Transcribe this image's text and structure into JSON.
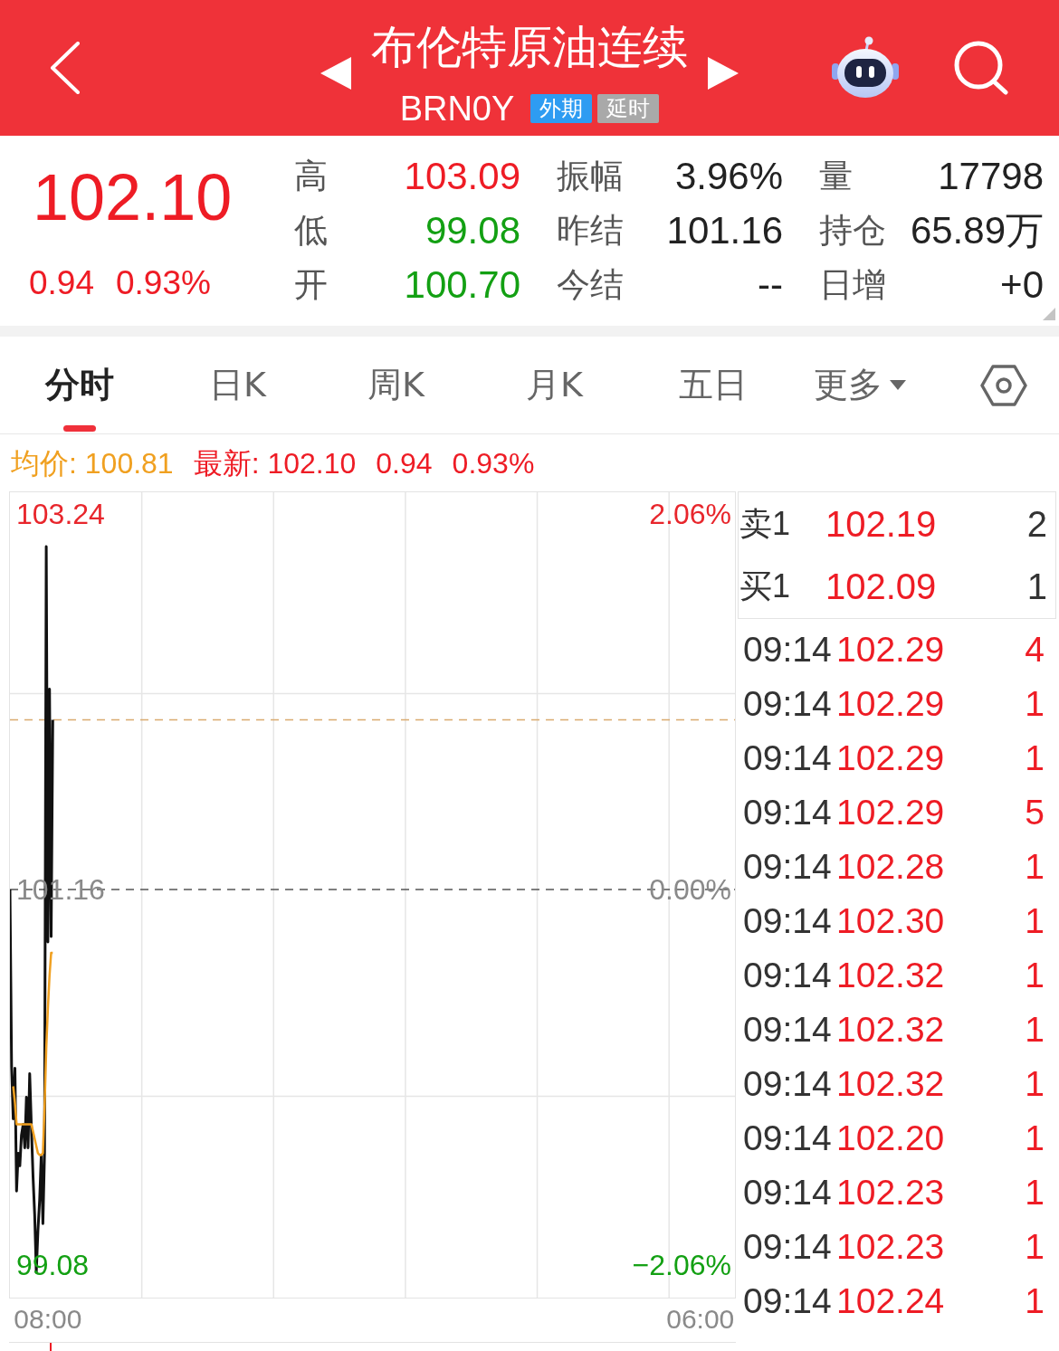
{
  "header": {
    "title": "布伦特原油连续",
    "code": "BRN0Y",
    "badges": [
      {
        "label": "外期",
        "color": "#2e9cf2"
      },
      {
        "label": "延时",
        "color": "#a9a9a9"
      }
    ]
  },
  "quote": {
    "price": {
      "text": "102.10",
      "color": "#ee1c25"
    },
    "changes": [
      {
        "text": "0.94",
        "color": "#ee1c25"
      },
      {
        "text": "0.93%",
        "color": "#ee1c25"
      }
    ],
    "stats": [
      {
        "label": "高",
        "value": "103.09",
        "color": "#ee1c25"
      },
      {
        "label": "振幅",
        "value": "3.96%",
        "color": "#222222"
      },
      {
        "label": "量",
        "value": "17798",
        "color": "#222222"
      },
      {
        "label": "低",
        "value": "99.08",
        "color": "#13a013"
      },
      {
        "label": "昨结",
        "value": "101.16",
        "color": "#222222"
      },
      {
        "label": "持仓",
        "value": "65.89万",
        "color": "#222222"
      },
      {
        "label": "开",
        "value": "100.70",
        "color": "#13a013"
      },
      {
        "label": "今结",
        "value": "--",
        "color": "#222222"
      },
      {
        "label": "日增",
        "value": "+0",
        "color": "#222222"
      }
    ]
  },
  "tabs": [
    {
      "label": "分时",
      "selected": true,
      "kind": "view"
    },
    {
      "label": "日K",
      "selected": false,
      "kind": "view"
    },
    {
      "label": "周K",
      "selected": false,
      "kind": "view"
    },
    {
      "label": "月K",
      "selected": false,
      "kind": "view"
    },
    {
      "label": "五日",
      "selected": false,
      "kind": "view"
    },
    {
      "label": "更多",
      "selected": false,
      "kind": "dropdown"
    }
  ],
  "info_line": [
    {
      "text": "均价: 100.81",
      "color": "#f0a020"
    },
    {
      "text": "最新: 102.10",
      "color": "#ee1c25"
    },
    {
      "text": "0.94",
      "color": "#ee1c25"
    },
    {
      "text": "0.93%",
      "color": "#ee1c25"
    }
  ],
  "chart": {
    "change_labels": [
      "2.06%",
      "0.00%",
      "−2.06%"
    ],
    "chart_data": {
      "type": "line",
      "categories": [
        null,
        null,
        null,
        null,
        null,
        null,
        null,
        null,
        null,
        null,
        null,
        null,
        null,
        null,
        null,
        null,
        null,
        null,
        null,
        null,
        null,
        null,
        null,
        "08:00",
        null,
        null,
        null,
        null,
        null,
        null,
        null,
        null,
        null,
        null,
        null,
        null,
        null,
        null,
        null,
        null,
        null,
        null,
        null,
        null,
        null,
        null,
        null,
        null,
        null,
        null,
        null,
        null,
        null,
        null,
        null,
        null,
        null,
        null,
        null,
        null,
        null,
        null,
        null,
        null,
        null,
        null,
        null,
        null,
        null,
        null,
        null,
        null,
        null,
        null,
        null,
        null,
        null,
        null,
        null,
        null,
        null,
        null,
        null,
        null,
        null,
        null,
        null,
        null,
        null,
        null,
        null,
        null,
        null,
        null,
        null,
        null,
        null,
        null,
        null,
        null,
        null,
        null,
        null,
        null,
        null,
        null,
        null,
        null,
        null,
        null,
        null,
        null,
        null,
        null,
        null,
        null,
        null,
        null,
        null,
        null,
        null,
        null,
        null,
        null,
        null,
        null,
        null,
        null,
        null,
        null,
        null,
        null,
        null,
        null,
        null,
        null,
        null,
        null,
        null,
        null,
        null,
        null,
        null,
        null,
        null,
        null,
        null,
        null,
        null,
        null,
        null,
        null,
        null,
        null,
        null,
        null,
        null,
        null,
        null,
        null,
        null,
        null,
        null,
        null,
        null,
        null,
        null,
        null,
        null,
        null,
        null,
        null,
        null,
        null,
        null,
        null,
        null,
        null,
        null,
        null,
        null,
        null,
        null,
        null,
        null,
        null,
        null,
        null,
        null,
        null,
        null,
        null,
        null,
        null,
        null,
        null,
        null,
        null,
        null,
        null,
        null,
        null,
        null,
        null,
        null,
        null,
        null,
        null,
        null,
        null,
        null,
        null,
        null,
        null,
        null,
        null,
        null,
        null,
        null,
        null,
        null,
        null,
        null,
        null,
        null,
        null,
        null,
        null,
        null,
        null,
        null,
        null,
        null,
        null,
        null,
        null,
        null,
        null,
        null,
        null,
        null,
        null,
        null,
        null,
        null,
        null,
        null,
        null,
        null,
        null,
        null,
        null,
        null,
        null,
        null,
        null,
        null,
        null,
        null,
        null,
        null,
        null,
        null,
        null,
        null,
        null,
        null,
        null,
        null,
        null,
        null,
        null,
        null,
        null,
        null,
        null,
        null,
        null,
        null,
        null,
        null,
        null,
        null,
        null,
        null,
        null,
        null,
        null,
        null,
        null,
        null,
        null,
        null,
        null,
        null,
        null,
        null,
        null,
        null,
        null,
        null,
        null,
        null,
        null,
        null,
        null,
        null,
        null,
        null,
        null,
        null,
        null,
        null,
        null,
        null,
        null,
        null,
        null,
        null,
        null,
        null,
        null,
        null,
        null,
        null,
        null,
        null,
        null,
        null,
        null,
        null,
        null,
        null,
        null,
        null,
        null,
        null,
        null,
        null,
        null,
        null,
        null,
        null,
        null,
        null,
        null,
        null,
        null,
        null,
        null,
        null,
        null,
        null,
        null,
        null,
        null,
        null,
        null,
        null,
        null,
        null,
        null,
        null,
        null,
        null,
        null,
        null,
        null,
        null,
        null,
        null,
        null,
        null,
        null,
        null,
        null,
        null,
        null,
        null,
        null,
        null,
        null,
        null,
        null,
        null,
        null,
        null,
        null,
        null,
        null,
        null,
        null,
        null,
        null,
        null,
        null,
        null,
        null,
        null,
        null,
        null,
        null,
        null,
        null,
        null,
        null,
        null,
        null,
        null,
        null,
        null,
        null,
        null,
        null,
        null,
        null,
        null,
        null,
        null,
        "06:00",
        null,
        null,
        null,
        null,
        null,
        null,
        null,
        null,
        null,
        null,
        null,
        null,
        null,
        null,
        null,
        null,
        null,
        null,
        null,
        null,
        null
      ],
      "series": [
        {
          "color": "#111111",
          "values": [
            101.16,
            100.18,
            99.89,
            100.17,
            99.49,
            99.7,
            99.63,
            99.8,
            99.86,
            99.73,
            100.01,
            99.73,
            100.14,
            99.84,
            99.57,
            99.36,
            99.04,
            99.27,
            99.44,
            99.69,
            99.31,
            99.7,
            103.06,
            100.87,
            102.27,
            100.9,
            102.1,
            null,
            null,
            null,
            null,
            null,
            null,
            null,
            null,
            null,
            null,
            null,
            null,
            null,
            null,
            null,
            null,
            null,
            null,
            null,
            null,
            null,
            null,
            null,
            null,
            null,
            null,
            null,
            null,
            null,
            null,
            null,
            null,
            null,
            null,
            null,
            null,
            null,
            null,
            null,
            null,
            null,
            null,
            null,
            null,
            null,
            null,
            null,
            null,
            null,
            null,
            null,
            null,
            null,
            null,
            null,
            null,
            null,
            null,
            null,
            null,
            null,
            null,
            null,
            null,
            null,
            null,
            null,
            null,
            null,
            null,
            null,
            null,
            null,
            null,
            null,
            null,
            null,
            null,
            null,
            null,
            null,
            null,
            null,
            null,
            null,
            null,
            null,
            null,
            null,
            null,
            null,
            null,
            null,
            null,
            null,
            null,
            null,
            null,
            null,
            null,
            null,
            null,
            null,
            null,
            null,
            null,
            null,
            null,
            null,
            null,
            null,
            null,
            null,
            null,
            null,
            null,
            null,
            null,
            null,
            null,
            null,
            null,
            null,
            null,
            null,
            null,
            null,
            null,
            null,
            null,
            null,
            null,
            null,
            null,
            null,
            null,
            null,
            null,
            null,
            null,
            null,
            null,
            null,
            null,
            null,
            null,
            null,
            null,
            null,
            null,
            null,
            null,
            null,
            null,
            null,
            null,
            null,
            null,
            null,
            null,
            null,
            null,
            null,
            null,
            null,
            null,
            null,
            null,
            null,
            null,
            null,
            null,
            null,
            null,
            null,
            null,
            null,
            null,
            null,
            null,
            null,
            null,
            null,
            null,
            null,
            null,
            null,
            null,
            null,
            null,
            null,
            null,
            null,
            null,
            null,
            null,
            null,
            null,
            null,
            null,
            null,
            null,
            null,
            null,
            null,
            null,
            null,
            null,
            null,
            null,
            null,
            null,
            null,
            null,
            null,
            null,
            null,
            null,
            null,
            null,
            null,
            null,
            null,
            null,
            null,
            null,
            null,
            null,
            null,
            null,
            null,
            null,
            null,
            null,
            null,
            null,
            null,
            null,
            null,
            null,
            null,
            null,
            null,
            null,
            null,
            null,
            null,
            null,
            null,
            null,
            null,
            null,
            null,
            null,
            null,
            null,
            null,
            null,
            null,
            null,
            null,
            null,
            null,
            null,
            null,
            null,
            null,
            null,
            null,
            null,
            null,
            null,
            null,
            null,
            null,
            null,
            null,
            null,
            null,
            null,
            null,
            null,
            null,
            null,
            null,
            null,
            null,
            null,
            null,
            null,
            null,
            null,
            null,
            null,
            null,
            null,
            null,
            null,
            null,
            null,
            null,
            null,
            null,
            null,
            null,
            null,
            null,
            null,
            null,
            null,
            null,
            null,
            null,
            null,
            null,
            null,
            null,
            null,
            null,
            null,
            null,
            null,
            null,
            null,
            null,
            null,
            null,
            null,
            null,
            null,
            null,
            null,
            null,
            null,
            null,
            null,
            null,
            null,
            null,
            null,
            null,
            null,
            null,
            null,
            null,
            null,
            null,
            null,
            null,
            null,
            null,
            null,
            null,
            null,
            null,
            null,
            null,
            null,
            null,
            null,
            null,
            null,
            null,
            null,
            null,
            null,
            null,
            null,
            null,
            null,
            null,
            null,
            null,
            null,
            null,
            null,
            null,
            null,
            null,
            null,
            null,
            null,
            null,
            null,
            null,
            null,
            null,
            null,
            null,
            null,
            null,
            null,
            null,
            null,
            null,
            null,
            null,
            null,
            null,
            null,
            null,
            null,
            null,
            null,
            null,
            null,
            null,
            null,
            null,
            null,
            null,
            null,
            null,
            null
          ]
        },
        {
          "color": "#f0a020",
          "values": [
            null,
            null,
            100.07,
            99.98,
            99.86,
            99.86,
            99.86,
            99.86,
            99.86,
            99.86,
            99.86,
            99.86,
            99.86,
            99.86,
            99.82,
            99.78,
            99.74,
            99.7,
            99.69,
            99.69,
            99.7,
            99.95,
            100.28,
            100.5,
            100.68,
            100.81,
            100.81,
            null,
            null,
            null,
            null,
            null,
            null,
            null,
            null,
            null,
            null,
            null,
            null,
            null,
            null,
            null,
            null,
            null,
            null,
            null,
            null,
            null,
            null,
            null,
            null,
            null,
            null,
            null,
            null,
            null,
            null,
            null,
            null,
            null,
            null,
            null,
            null,
            null,
            null,
            null,
            null,
            null,
            null,
            null,
            null,
            null,
            null,
            null,
            null,
            null,
            null,
            null,
            null,
            null,
            null,
            null,
            null,
            null,
            null,
            null,
            null,
            null,
            null,
            null,
            null,
            null,
            null,
            null,
            null,
            null,
            null,
            null,
            null,
            null,
            null,
            null,
            null,
            null,
            null,
            null,
            null,
            null,
            null,
            null,
            null,
            null,
            null,
            null,
            null,
            null,
            null,
            null,
            null,
            null,
            null,
            null,
            null,
            null,
            null,
            null,
            null,
            null,
            null,
            null,
            null,
            null,
            null,
            null,
            null,
            null,
            null,
            null,
            null,
            null,
            null,
            null,
            null,
            null,
            null,
            null,
            null,
            null,
            null,
            null,
            null,
            null,
            null,
            null,
            null,
            null,
            null,
            null,
            null,
            null,
            null,
            null,
            null,
            null,
            null,
            null,
            null,
            null,
            null,
            null,
            null,
            null,
            null,
            null,
            null,
            null,
            null,
            null,
            null,
            null,
            null,
            null,
            null,
            null,
            null,
            null,
            null,
            null,
            null,
            null,
            null,
            null,
            null,
            null,
            null,
            null,
            null,
            null,
            null,
            null,
            null,
            null,
            null,
            null,
            null,
            null,
            null,
            null,
            null,
            null,
            null,
            null,
            null,
            null,
            null,
            null,
            null,
            null,
            null,
            null,
            null,
            null,
            null,
            null,
            null,
            null,
            null,
            null,
            null,
            null,
            null,
            null,
            null,
            null,
            null,
            null,
            null,
            null,
            null,
            null,
            null,
            null,
            null,
            null,
            null,
            null,
            null,
            null,
            null,
            null,
            null,
            null,
            null,
            null,
            null,
            null,
            null,
            null,
            null,
            null,
            null,
            null,
            null,
            null,
            null,
            null,
            null,
            null,
            null,
            null,
            null,
            null,
            null,
            null,
            null,
            null,
            null,
            null,
            null,
            null,
            null,
            null,
            null,
            null,
            null,
            null,
            null,
            null,
            null,
            null,
            null,
            null,
            null,
            null,
            null,
            null,
            null,
            null,
            null,
            null,
            null,
            null,
            null,
            null,
            null,
            null,
            null,
            null,
            null,
            null,
            null,
            null,
            null,
            null,
            null,
            null,
            null,
            null,
            null,
            null,
            null,
            null,
            null,
            null,
            null,
            null,
            null,
            null,
            null,
            null,
            null,
            null,
            null,
            null,
            null,
            null,
            null,
            null,
            null,
            null,
            null,
            null,
            null,
            null,
            null,
            null,
            null,
            null,
            null,
            null,
            null,
            null,
            null,
            null,
            null,
            null,
            null,
            null,
            null,
            null,
            null,
            null,
            null,
            null,
            null,
            null,
            null,
            null,
            null,
            null,
            null,
            null,
            null,
            null,
            null,
            null,
            null,
            null,
            null,
            null,
            null,
            null,
            null,
            null,
            null,
            null,
            null,
            null,
            null,
            null,
            null,
            null,
            null,
            null,
            null,
            null,
            null,
            null,
            null,
            null,
            null,
            null,
            null,
            null,
            null,
            null,
            null,
            null,
            null,
            null,
            null,
            null,
            null,
            null,
            null,
            null,
            null,
            null,
            null,
            null,
            null,
            null,
            null,
            null,
            null,
            null,
            null,
            null,
            null,
            null,
            null,
            null,
            null,
            null,
            null,
            null,
            null,
            null,
            null,
            null,
            null
          ]
        }
      ],
      "ylim": [
        98.9,
        103.36
      ],
      "yticks": [
        {
          "value": 103.24,
          "label": "103.24"
        },
        {
          "value": 101.16,
          "label": "101.16"
        },
        {
          "value": 99.08,
          "label": "99.08"
        }
      ],
      "ref_lines": [
        {
          "axis": "y",
          "value": 102.1,
          "color": "#d9aa6e"
        },
        {
          "axis": "y",
          "value": 101.16,
          "color": "#555555"
        }
      ]
    }
  },
  "order_book": [
    {
      "label": "卖1",
      "price": "102.19",
      "volume": "2"
    },
    {
      "label": "买1",
      "price": "102.09",
      "volume": "1"
    }
  ],
  "trades": [
    {
      "time": "09:14",
      "price": "102.29",
      "volume": "4"
    },
    {
      "time": "09:14",
      "price": "102.29",
      "volume": "1"
    },
    {
      "time": "09:14",
      "price": "102.29",
      "volume": "1"
    },
    {
      "time": "09:14",
      "price": "102.29",
      "volume": "5"
    },
    {
      "time": "09:14",
      "price": "102.28",
      "volume": "1"
    },
    {
      "time": "09:14",
      "price": "102.30",
      "volume": "1"
    },
    {
      "time": "09:14",
      "price": "102.32",
      "volume": "1"
    },
    {
      "time": "09:14",
      "price": "102.32",
      "volume": "1"
    },
    {
      "time": "09:14",
      "price": "102.32",
      "volume": "1"
    },
    {
      "time": "09:14",
      "price": "102.20",
      "volume": "1"
    },
    {
      "time": "09:14",
      "price": "102.23",
      "volume": "1"
    },
    {
      "time": "09:14",
      "price": "102.23",
      "volume": "1"
    },
    {
      "time": "09:14",
      "price": "102.24",
      "volume": "1"
    }
  ]
}
